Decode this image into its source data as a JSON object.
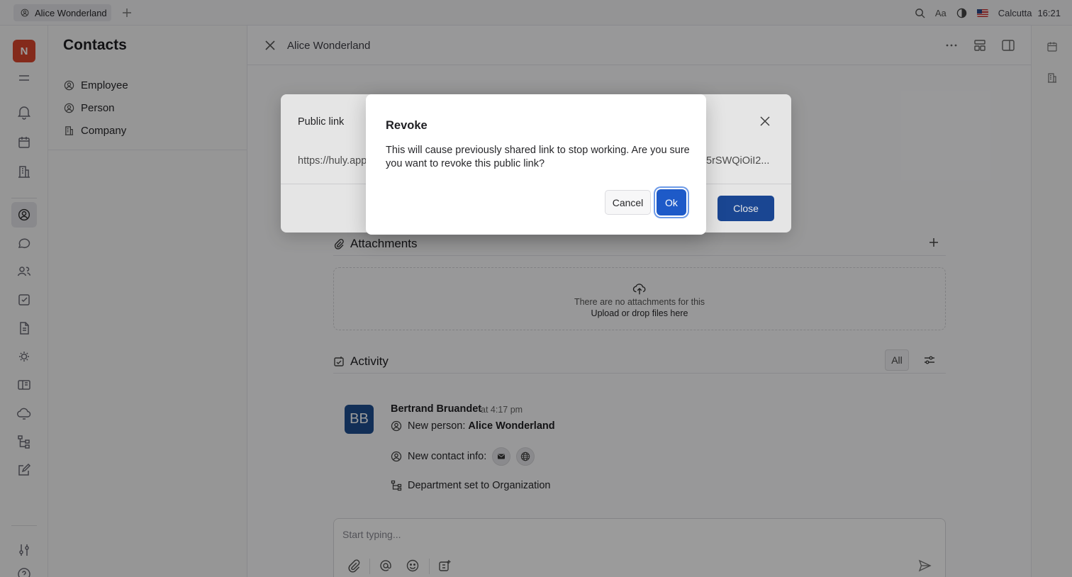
{
  "topbar": {
    "tab_label": "Alice Wonderland",
    "zoom_label": "Aa",
    "location": "Calcutta",
    "time": "16:21"
  },
  "rail": {
    "workspace_initial": "N"
  },
  "navigator": {
    "title": "Contacts",
    "items": [
      {
        "label": "Employee",
        "icon": "person-circle-icon"
      },
      {
        "label": "Person",
        "icon": "person-circle-icon"
      },
      {
        "label": "Company",
        "icon": "building-icon"
      }
    ]
  },
  "main": {
    "header_title": "Alice Wonderland",
    "attachments": {
      "title": "Attachments",
      "empty_text": "There are no attachments for this",
      "upload_text": "Upload or drop files here"
    },
    "activity": {
      "title": "Activity",
      "filter_label": "All",
      "author_initials": "BB",
      "author": "Bertrand Bruandet",
      "time": "at 4:17 pm",
      "line1_prefix": "New person:",
      "line1_value": "Alice Wonderland",
      "line2_prefix": "New contact info:",
      "line3": "Department set to Organization"
    },
    "composer_placeholder": "Start typing..."
  },
  "public_link_dialog": {
    "title": "Public link",
    "link_start": "https://huly.app",
    "link_end": "5rSWQiOiI2...",
    "close_label": "Close"
  },
  "revoke_dialog": {
    "title": "Revoke",
    "message": "This will cause previously shared link to stop working. Are you sure you want to revoke this public link?",
    "cancel_label": "Cancel",
    "ok_label": "Ok"
  },
  "colors": {
    "primary_button": "#1e4fa3",
    "ok_button": "#1e5ac8",
    "workspace_badge": "#d9462f",
    "avatar_bg": "#1f4f8f"
  }
}
